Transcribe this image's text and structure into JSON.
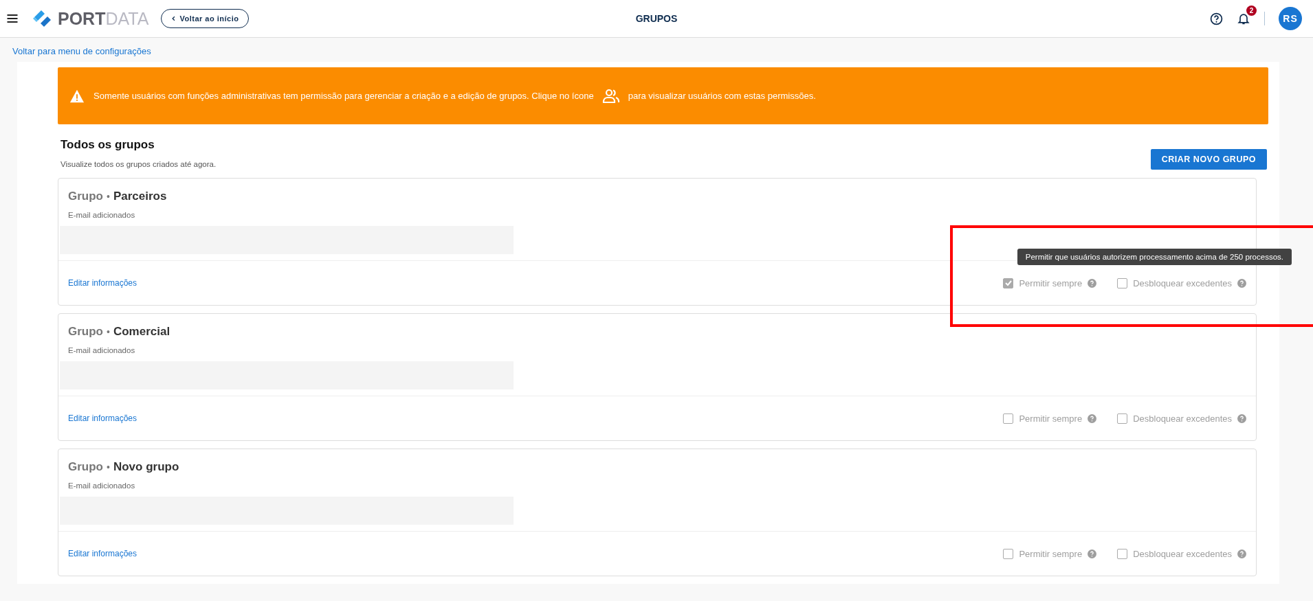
{
  "header": {
    "logo": {
      "part_1": "PORT",
      "part_2": "DATA"
    },
    "back_button": "Voltar ao início",
    "title": "GRUPOS",
    "notifications": {
      "count": "2"
    },
    "avatar": "RS"
  },
  "back_link": "Voltar para menu de configurações",
  "banner": {
    "text_before_icon": "Somente usuários com funções administrativas tem permissão para gerenciar a criação e a edição de grupos. Clique no ícone",
    "text_after_icon": "para visualizar usuários com estas permissões."
  },
  "section": {
    "title": "Todos os grupos",
    "subtitle": "Visualize todos os grupos criados até agora.",
    "create_button": "CRIAR NOVO GRUPO"
  },
  "groups": [
    {
      "prefix": "Grupo",
      "separator": "•",
      "name": "Parceiros",
      "emails_label": "E-mail adicionados",
      "edit_link": "Editar informações",
      "options": [
        {
          "label": "Permitir sempre",
          "checked": true
        },
        {
          "label": "Desbloquear excedentes",
          "checked": false
        }
      ],
      "tooltip": "Permitir que usuários autorizem processamento acima de 250 processos.",
      "annotation": {
        "kind": "rectangle",
        "color": "#ff0000"
      }
    },
    {
      "prefix": "Grupo",
      "separator": "•",
      "name": "Comercial",
      "emails_label": "E-mail adicionados",
      "edit_link": "Editar informações",
      "options": [
        {
          "label": "Permitir sempre",
          "checked": false
        },
        {
          "label": "Desbloquear excedentes",
          "checked": false
        }
      ]
    },
    {
      "prefix": "Grupo",
      "separator": "•",
      "name": "Novo grupo",
      "emails_label": "E-mail adicionados",
      "edit_link": "Editar informações",
      "options": [
        {
          "label": "Permitir sempre",
          "checked": false
        },
        {
          "label": "Desbloquear excedentes",
          "checked": false
        }
      ]
    }
  ]
}
